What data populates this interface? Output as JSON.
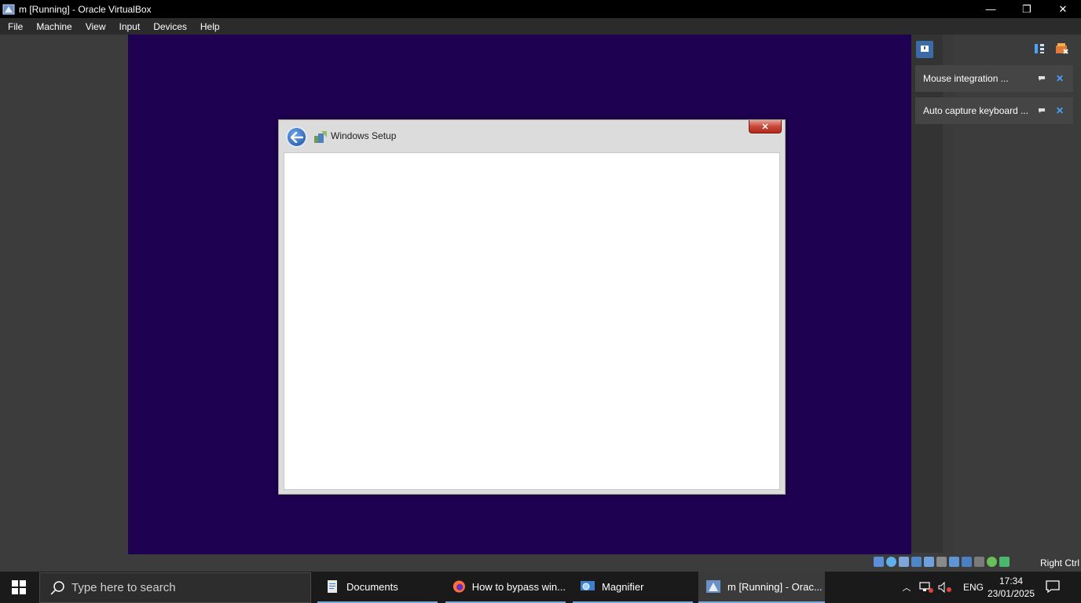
{
  "window": {
    "title": "m [Running] - Oracle VirtualBox",
    "controls": {
      "minimize": "—",
      "maximize": "❐",
      "close": "✕"
    }
  },
  "menubar": {
    "items": [
      "File",
      "Machine",
      "View",
      "Input",
      "Devices",
      "Help"
    ]
  },
  "dialog": {
    "title": "Windows Setup",
    "close_glyph": "✕"
  },
  "notifications": [
    {
      "text": "Mouse integration ...",
      "close": "✕"
    },
    {
      "text": "Auto capture keyboard ...",
      "close": "✕"
    }
  ],
  "statusbar": {
    "host_key": "Right Ctrl"
  },
  "taskbar": {
    "search_placeholder": "Type here to search",
    "items": [
      {
        "label": "Documents",
        "icon": "documents-icon"
      },
      {
        "label": "How to bypass win...",
        "icon": "firefox-icon"
      },
      {
        "label": "Magnifier",
        "icon": "magnifier-icon"
      },
      {
        "label": "m [Running] - Orac...",
        "icon": "virtualbox-icon"
      }
    ],
    "language": "ENG",
    "time": "17:34",
    "date": "23/01/2025"
  },
  "colors": {
    "vm_background": "#1e0150",
    "accent": "#4aa3ff"
  }
}
